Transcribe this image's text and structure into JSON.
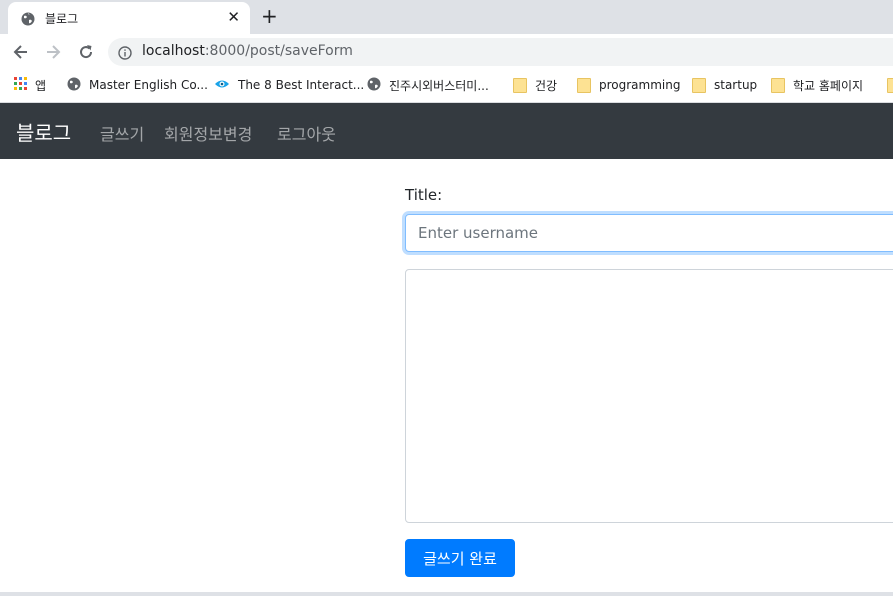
{
  "browser": {
    "tab_title": "블로그",
    "tab_close": "✕",
    "new_tab": "+",
    "url_host": "localhost",
    "url_path": ":8000/post/saveForm",
    "bookmarks": [
      {
        "label": "앱",
        "icon": "apps-grid-icon"
      },
      {
        "label": "Master English Co...",
        "icon": "globe-icon"
      },
      {
        "label": "The 8 Best Interact...",
        "icon": "eye-icon"
      },
      {
        "label": "진주시외버스터미...",
        "icon": "globe-icon"
      },
      {
        "label": "건강",
        "icon": "folder-icon"
      },
      {
        "label": "programming",
        "icon": "folder-icon"
      },
      {
        "label": "startup",
        "icon": "folder-icon"
      },
      {
        "label": "학교 홈페이지",
        "icon": "folder-icon"
      }
    ]
  },
  "navbar": {
    "brand": "블로그",
    "links": [
      "글쓰기",
      "회원정보변경",
      "로그아웃"
    ],
    "background": "#343a40"
  },
  "form": {
    "title_label": "Title:",
    "title_placeholder": "Enter username",
    "title_value": "",
    "content_value": "",
    "submit_label": "글쓰기 완료",
    "submit_color": "#007bff"
  }
}
